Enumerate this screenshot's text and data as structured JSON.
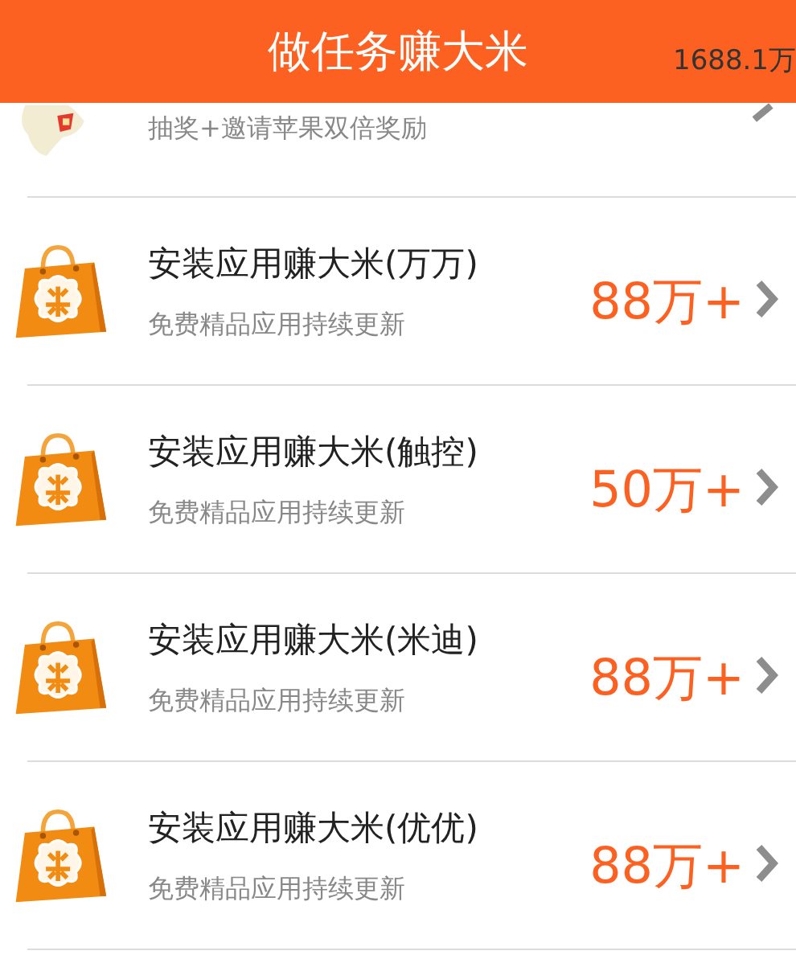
{
  "header": {
    "title": "做任务赚大米",
    "balance": "1688.1万"
  },
  "partial_task": {
    "subtitle": "抽奖+邀请苹果双倍奖励"
  },
  "tasks": [
    {
      "title": "安装应用赚大米(万万)",
      "subtitle": "免费精品应用持续更新",
      "reward": "88万+"
    },
    {
      "title": "安装应用赚大米(触控)",
      "subtitle": "免费精品应用持续更新",
      "reward": "50万+"
    },
    {
      "title": "安装应用赚大米(米迪)",
      "subtitle": "免费精品应用持续更新",
      "reward": "88万+"
    },
    {
      "title": "安装应用赚大米(优优)",
      "subtitle": "免费精品应用持续更新",
      "reward": "88万+"
    }
  ]
}
